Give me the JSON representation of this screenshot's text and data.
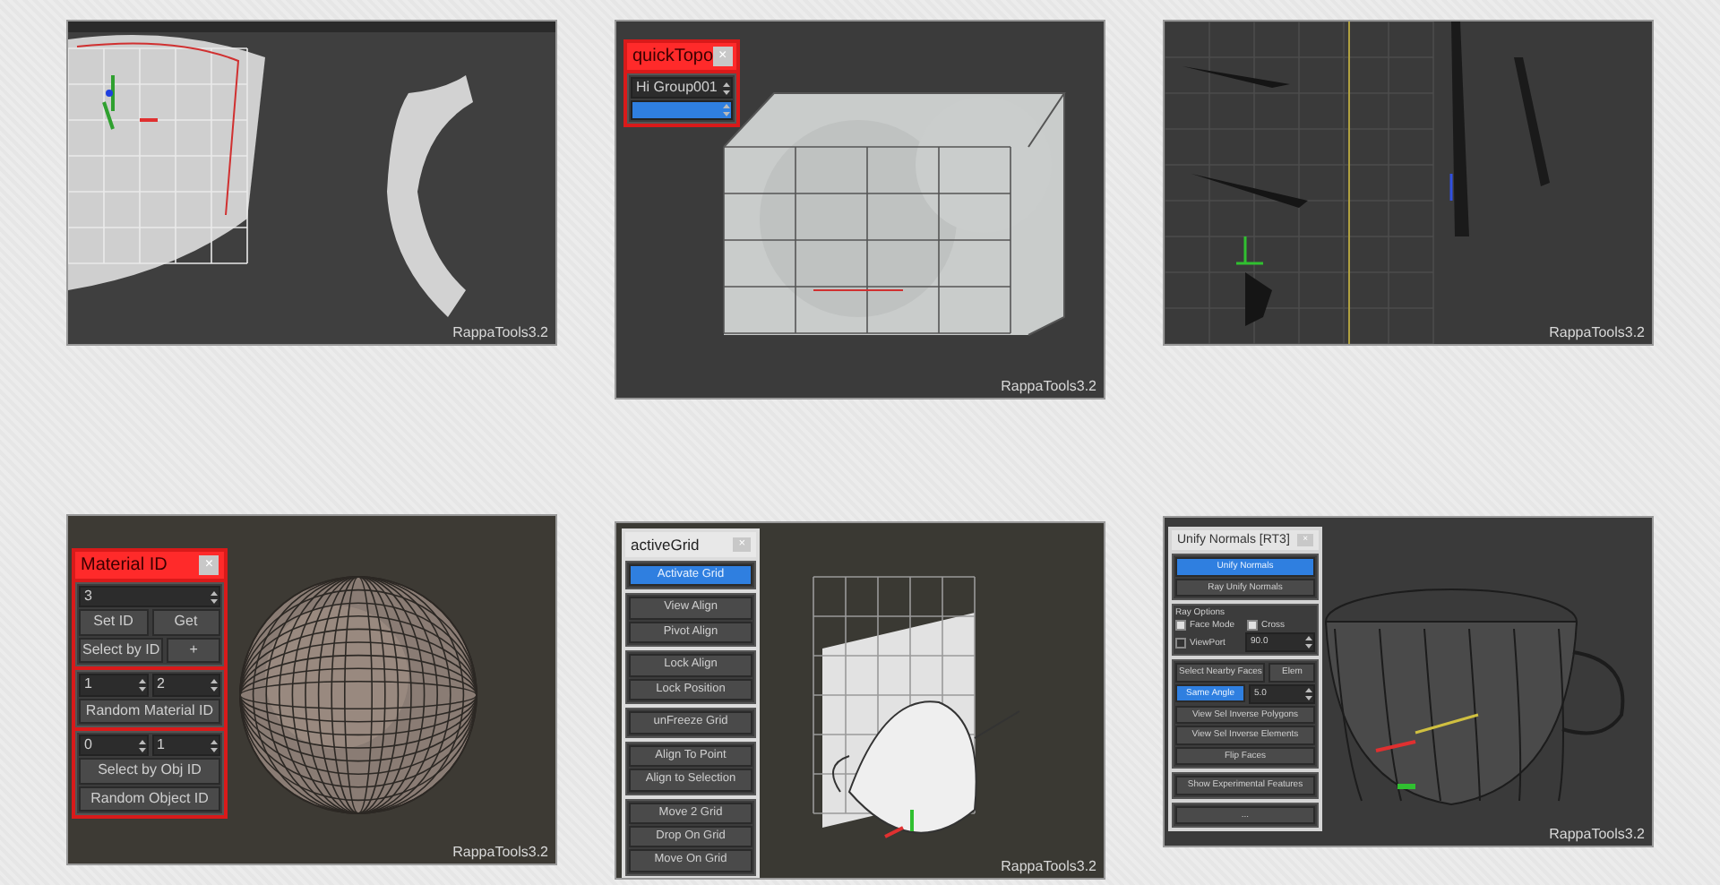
{
  "panels": [
    {
      "kind": "mesh_strips",
      "watermark": "RappaTools3.2"
    },
    {
      "kind": "cube_sphere",
      "watermark": "RappaTools3.2",
      "dialog": {
        "title": "quickTopo",
        "close": "×",
        "groups": [
          [
            [
              {
                "kind": "field",
                "text": "Hi Group001"
              }
            ],
            [
              {
                "kind": "field",
                "selected": true
              }
            ]
          ]
        ]
      }
    },
    {
      "kind": "knife_views",
      "watermark": "RappaTools3.2"
    },
    {
      "kind": "sphere",
      "watermark": "RappaTools3.2",
      "dialog": {
        "title": "Material ID",
        "close": "×",
        "groups": [
          [
            [
              {
                "kind": "field",
                "text": "3"
              }
            ],
            [
              {
                "kind": "button",
                "text": "Set ID",
                "selected": false
              },
              {
                "kind": "button",
                "text": "Get",
                "selected": false
              }
            ],
            [
              {
                "kind": "button",
                "text": "Select by ID",
                "selected": false
              },
              {
                "kind": "button",
                "text": "+",
                "selected": false
              }
            ]
          ],
          [
            [
              {
                "kind": "field",
                "text": "1"
              },
              {
                "kind": "field",
                "text": "2"
              }
            ],
            [
              {
                "kind": "button",
                "text": "Random Material ID",
                "selected": false
              }
            ]
          ],
          [
            [
              {
                "kind": "field",
                "text": "0"
              },
              {
                "kind": "field",
                "text": "1"
              }
            ],
            [
              {
                "kind": "button",
                "text": "Select by Obj ID",
                "selected": false
              }
            ],
            [
              {
                "kind": "button",
                "text": "Random Object ID",
                "selected": false
              }
            ]
          ]
        ]
      }
    },
    {
      "kind": "teapot",
      "watermark": "RappaTools3.2",
      "dialog": {
        "title": "activeGrid",
        "close": "×",
        "groups": [
          [
            [
              {
                "kind": "button",
                "text": "Activate Grid",
                "selected": true
              }
            ]
          ],
          [
            [
              {
                "kind": "button",
                "text": "View Align",
                "selected": false
              }
            ],
            [
              {
                "kind": "button",
                "text": "Pivot Align",
                "selected": false
              }
            ]
          ],
          [
            [
              {
                "kind": "button",
                "text": "Lock Align",
                "selected": false
              }
            ],
            [
              {
                "kind": "button",
                "text": "Lock Position",
                "selected": false
              }
            ]
          ],
          [
            [
              {
                "kind": "button",
                "text": "unFreeze Grid",
                "selected": false
              }
            ]
          ],
          [
            [
              {
                "kind": "button",
                "text": "Align To Point",
                "selected": false
              }
            ],
            [
              {
                "kind": "button",
                "text": "Align to Selection",
                "selected": false
              }
            ]
          ],
          [
            [
              {
                "kind": "button",
                "text": "Move 2 Grid",
                "selected": false
              }
            ],
            [
              {
                "kind": "button",
                "text": "Drop On Grid",
                "selected": false
              }
            ],
            [
              {
                "kind": "button",
                "text": "Move On Grid",
                "selected": false
              }
            ]
          ]
        ]
      }
    },
    {
      "kind": "cup",
      "watermark": "RappaTools3.2",
      "dialog": {
        "title": "Unify Normals [RT3]",
        "close": "×",
        "groups": [
          [
            [
              {
                "kind": "button",
                "text": "Unify Normals",
                "selected": true
              }
            ],
            [
              {
                "kind": "button",
                "text": "Ray Unify Normals",
                "selected": false
              }
            ]
          ],
          [
            [
              {
                "kind": "label",
                "text": "Ray Options"
              }
            ],
            [
              {
                "kind": "checkbox",
                "text": "Face Mode",
                "checked": true
              },
              {
                "kind": "checkbox",
                "text": "Cross",
                "checked": true
              }
            ],
            [
              {
                "kind": "checkbox",
                "text": "ViewPort",
                "checked": false
              },
              {
                "kind": "field",
                "text": "90.0"
              }
            ]
          ],
          [
            [
              {
                "kind": "button",
                "text": "Select Nearby Faces",
                "selected": false
              },
              {
                "kind": "button",
                "text": "Elem",
                "selected": false
              }
            ],
            [
              {
                "kind": "button",
                "text": "Same Angle",
                "selected": true
              },
              {
                "kind": "field",
                "text": "5.0"
              }
            ],
            [
              {
                "kind": "button",
                "text": "View Sel Inverse Polygons",
                "selected": false
              }
            ],
            [
              {
                "kind": "button",
                "text": "View Sel Inverse Elements",
                "selected": false
              }
            ],
            [
              {
                "kind": "button",
                "text": "Flip Faces",
                "selected": false
              }
            ]
          ],
          [
            [
              {
                "kind": "button",
                "text": "Show Experimental Features",
                "selected": false
              }
            ]
          ],
          [
            [
              {
                "kind": "button",
                "text": "...",
                "selected": false
              }
            ]
          ]
        ]
      }
    }
  ]
}
